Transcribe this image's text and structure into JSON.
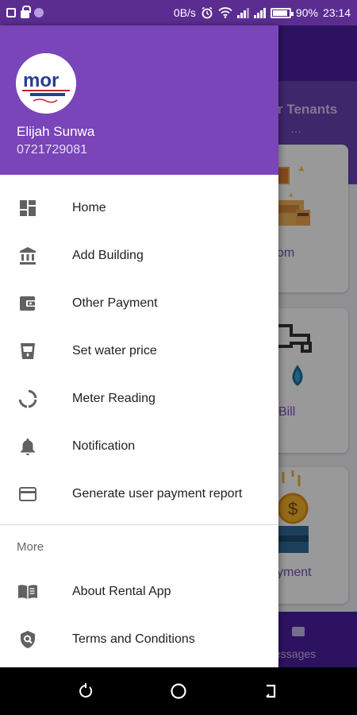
{
  "status_bar": {
    "net_speed": "0B/s",
    "battery": "90%",
    "time": "23:14"
  },
  "background": {
    "section_title": "r Tenants",
    "card_labels": [
      "om",
      "Bill",
      "yment"
    ],
    "bottom_tab_label": "essages"
  },
  "drawer": {
    "logo_text": "mor",
    "user_name": "Elijah Sunwa",
    "user_phone": "0721729081",
    "menu": [
      {
        "label": "Home",
        "icon": "dashboard-icon"
      },
      {
        "label": "Add Building",
        "icon": "bank-icon"
      },
      {
        "label": "Other Payment",
        "icon": "wallet-icon"
      },
      {
        "label": "Set water price",
        "icon": "water-glass-icon"
      },
      {
        "label": "Meter Reading",
        "icon": "meter-icon"
      },
      {
        "label": "Notification",
        "icon": "bell-icon"
      },
      {
        "label": "Generate user payment report",
        "icon": "credit-card-icon"
      }
    ],
    "more_title": "More",
    "more_menu": [
      {
        "label": "About Rental App",
        "icon": "book-icon"
      },
      {
        "label": "Terms and Conditions",
        "icon": "shield-search-icon"
      }
    ]
  },
  "colors": {
    "drawer_header": "#7a45b8",
    "status_bar": "#5b2d91",
    "icon_gray": "#616161"
  }
}
